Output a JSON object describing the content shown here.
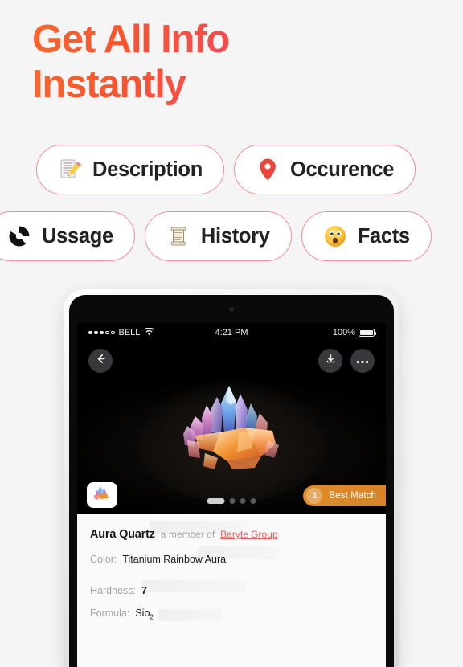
{
  "page": {
    "background_color": "#f5f5f5",
    "headline": "Get All Info\nInstantly",
    "headline_gradient_from": "#f9672e",
    "headline_gradient_to": "#f24a63"
  },
  "chip_rows": [
    {
      "chips": [
        {
          "label": "Description",
          "icon": "memo-pencil-icon"
        },
        {
          "label": "Occurence",
          "icon": "location-pin-icon"
        }
      ]
    },
    {
      "chips": [
        {
          "label": "Ussage",
          "icon": "pie-chart-icon"
        },
        {
          "label": "History",
          "icon": "scroll-icon"
        },
        {
          "label": "Facts",
          "icon": "astonished-face-icon"
        }
      ]
    }
  ],
  "device": {
    "status_bar": {
      "carrier": "BELL",
      "signal_dots_filled": 3,
      "signal_dots_empty": 2,
      "wifi_icon": "wifi-icon",
      "time": "4:21 PM",
      "battery_percent": "100%",
      "battery_icon": "battery-full-icon"
    },
    "nav": {
      "back_icon": "arrow-left-icon",
      "download_icon": "download-icon",
      "more_icon": "more-horizontal-icon"
    },
    "gallery": {
      "thumbnail_icon": "crystal-thumbnail-icon",
      "page_dots_total": 4,
      "page_dots_active_index": 0,
      "badge": {
        "rank": "1",
        "label": "Best Match",
        "color": "#d98327"
      }
    },
    "info_card": {
      "mineral_name": "Aura Quartz",
      "member_of_text": "a member of",
      "group_name": "Baryte Group",
      "group_link_color": "#ec5b5b",
      "properties": [
        {
          "key": "Color:",
          "value": "Titanium Rainbow Aura"
        },
        {
          "key": "Hardness:",
          "value": "7"
        },
        {
          "key": "Formula:",
          "value": "Sio",
          "subscript": "2"
        }
      ]
    }
  }
}
